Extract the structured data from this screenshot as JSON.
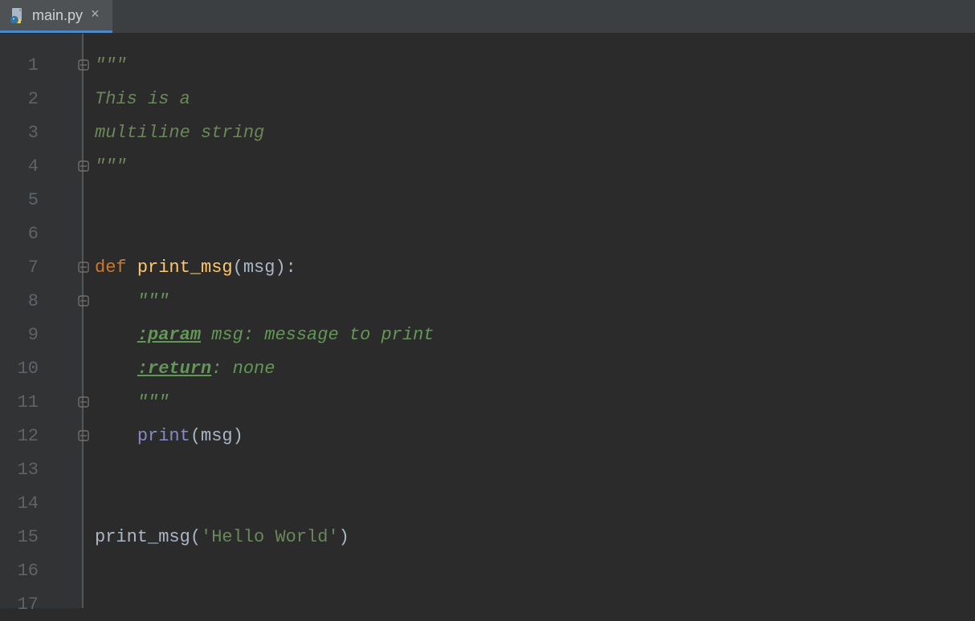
{
  "tab": {
    "filename": "main.py"
  },
  "gutter": {
    "lines": [
      "1",
      "2",
      "3",
      "4",
      "5",
      "6",
      "7",
      "8",
      "9",
      "10",
      "11",
      "12",
      "13",
      "14",
      "15",
      "16",
      "17"
    ]
  },
  "code": {
    "l1": {
      "a": "\"\"\""
    },
    "l2": {
      "a": "This is a"
    },
    "l3": {
      "a": "multiline string"
    },
    "l4": {
      "a": "\"\"\""
    },
    "l7": {
      "a": "def ",
      "b": "print_msg",
      "c": "(msg):"
    },
    "l8": {
      "a": "\"\"\""
    },
    "l9": {
      "a": ":param",
      "b": " msg: message to print"
    },
    "l10": {
      "a": ":return",
      "b": ": none"
    },
    "l11": {
      "a": "\"\"\""
    },
    "l12": {
      "a": "print",
      "b": "(msg)"
    },
    "l15": {
      "a": "print_msg(",
      "b": "'Hello World'",
      "c": ")"
    }
  }
}
